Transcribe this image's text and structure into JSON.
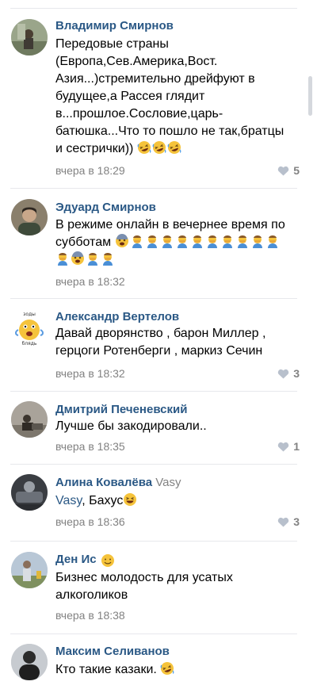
{
  "comments": [
    {
      "author": "Владимир Смирнов",
      "text": "Передовые страны (Европа,Сев.Америка,Вост. Азия...)стремительно дрейфуют в будущее,а Рассея глядит в...прошлое.Сословие,царь-батюшка...Что то пошло не так,братцы и сестрички))",
      "emoji": [
        "rofl",
        "rofl",
        "rofl"
      ],
      "time": "вчера в 18:29",
      "likes": "5"
    },
    {
      "author": "Эдуард Смирнов",
      "text": "В режиме онлайн в вечернее время по субботам",
      "emoji": [
        "fearful",
        "man-facepalm",
        "man-facepalm",
        "man-facepalm",
        "man-facepalm",
        "man-facepalm",
        "man-facepalm",
        "man-facepalm",
        "man-facepalm",
        "man-facepalm",
        "man-facepalm",
        "man-facepalm",
        "fearful",
        "man-facepalm",
        "man-facepalm"
      ],
      "time": "вчера в 18:32",
      "likes": ""
    },
    {
      "author": "Александр Вертелов",
      "text": "Давай дворянство , барон Миллер , герцоги Ротенберги , маркиз Сечин",
      "time": "вчера в 18:32",
      "likes": "3"
    },
    {
      "author": "Дмитрий Печеневский",
      "text": "Лучше бы закодировали..",
      "time": "вчера в 18:35",
      "likes": "1"
    },
    {
      "author": "Алина Ковалёва",
      "reply_to": "Vasy",
      "mention": "Vasy",
      "text": ", Бахус",
      "emoji": [
        "laughing"
      ],
      "time": "вчера в 18:36",
      "likes": "3"
    },
    {
      "author": "Ден Ис",
      "author_emoji": "smiling-face",
      "text": "Бизнес молодость для усатых алкоголиков",
      "time": "вчера в 18:38",
      "likes": ""
    },
    {
      "author": "Максим Селиванов",
      "text": "Кто такие казаки.",
      "emoji": [
        "rofl"
      ]
    }
  ],
  "icons": {
    "like": "heart-icon",
    "avatar_3_caption": "зоды блядь"
  },
  "colors": {
    "author": "#2a5885",
    "meta": "#828282",
    "divider": "#e7e8ec",
    "emoji": "#f5c33b"
  }
}
